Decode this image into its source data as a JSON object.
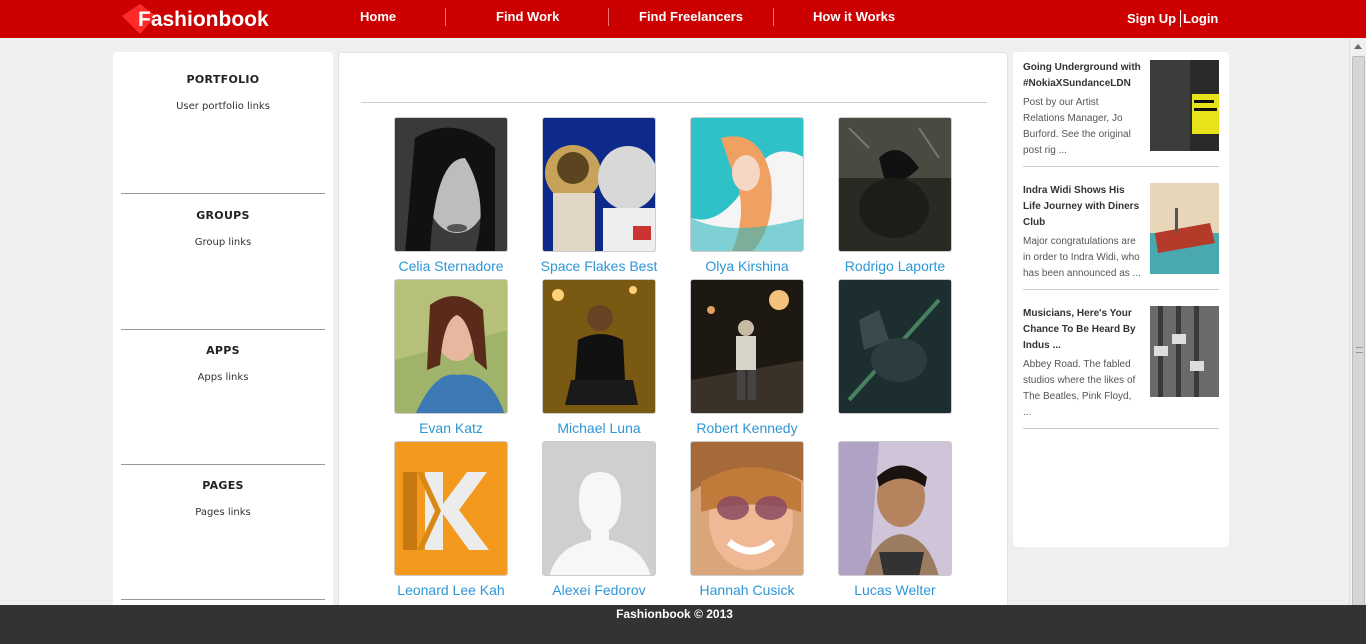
{
  "brand": {
    "name": "Fashionbook"
  },
  "nav": {
    "items": [
      {
        "label": "Home"
      },
      {
        "label": "Find Work"
      },
      {
        "label": "Find Freelancers"
      },
      {
        "label": "How it Works"
      }
    ],
    "signup": "Sign Up",
    "login": "Login"
  },
  "sidebar": {
    "sections": [
      {
        "title": "PORTFOLIO",
        "link": "User portfolio links"
      },
      {
        "title": "GROUPS",
        "link": "Group links"
      },
      {
        "title": "APPS",
        "link": "Apps links"
      },
      {
        "title": "PAGES",
        "link": "Pages links"
      }
    ]
  },
  "freelancers": [
    {
      "name": "Celia Sternadore"
    },
    {
      "name": "Space Flakes Best"
    },
    {
      "name": "Olya Kirshina"
    },
    {
      "name": "Rodrigo Laporte"
    },
    {
      "name": "Evan Katz"
    },
    {
      "name": "Michael Luna"
    },
    {
      "name": "Robert Kennedy"
    },
    {
      "name": ""
    },
    {
      "name": "Leonard Lee Kah"
    },
    {
      "name": "Alexei Fedorov"
    },
    {
      "name": "Hannah Cusick"
    },
    {
      "name": "Lucas Welter"
    }
  ],
  "news": [
    {
      "title": "Going Underground with #NokiaXSundanceLDN",
      "desc": "Post by our Artist Relations Manager, Jo Burford. See the original post rig ..."
    },
    {
      "title": "Indra Widi Shows His Life Journey with Diners Club",
      "desc": "Major congratulations are in order to Indra Widi, who has been announced as ..."
    },
    {
      "title": "Musicians, Here's Your Chance To Be Heard By Indus ...",
      "desc": "Abbey Road. The fabled studios where the likes of The Beatles, Pink Floyd, ..."
    }
  ],
  "footer": {
    "text": "Fashionbook © 2013"
  }
}
